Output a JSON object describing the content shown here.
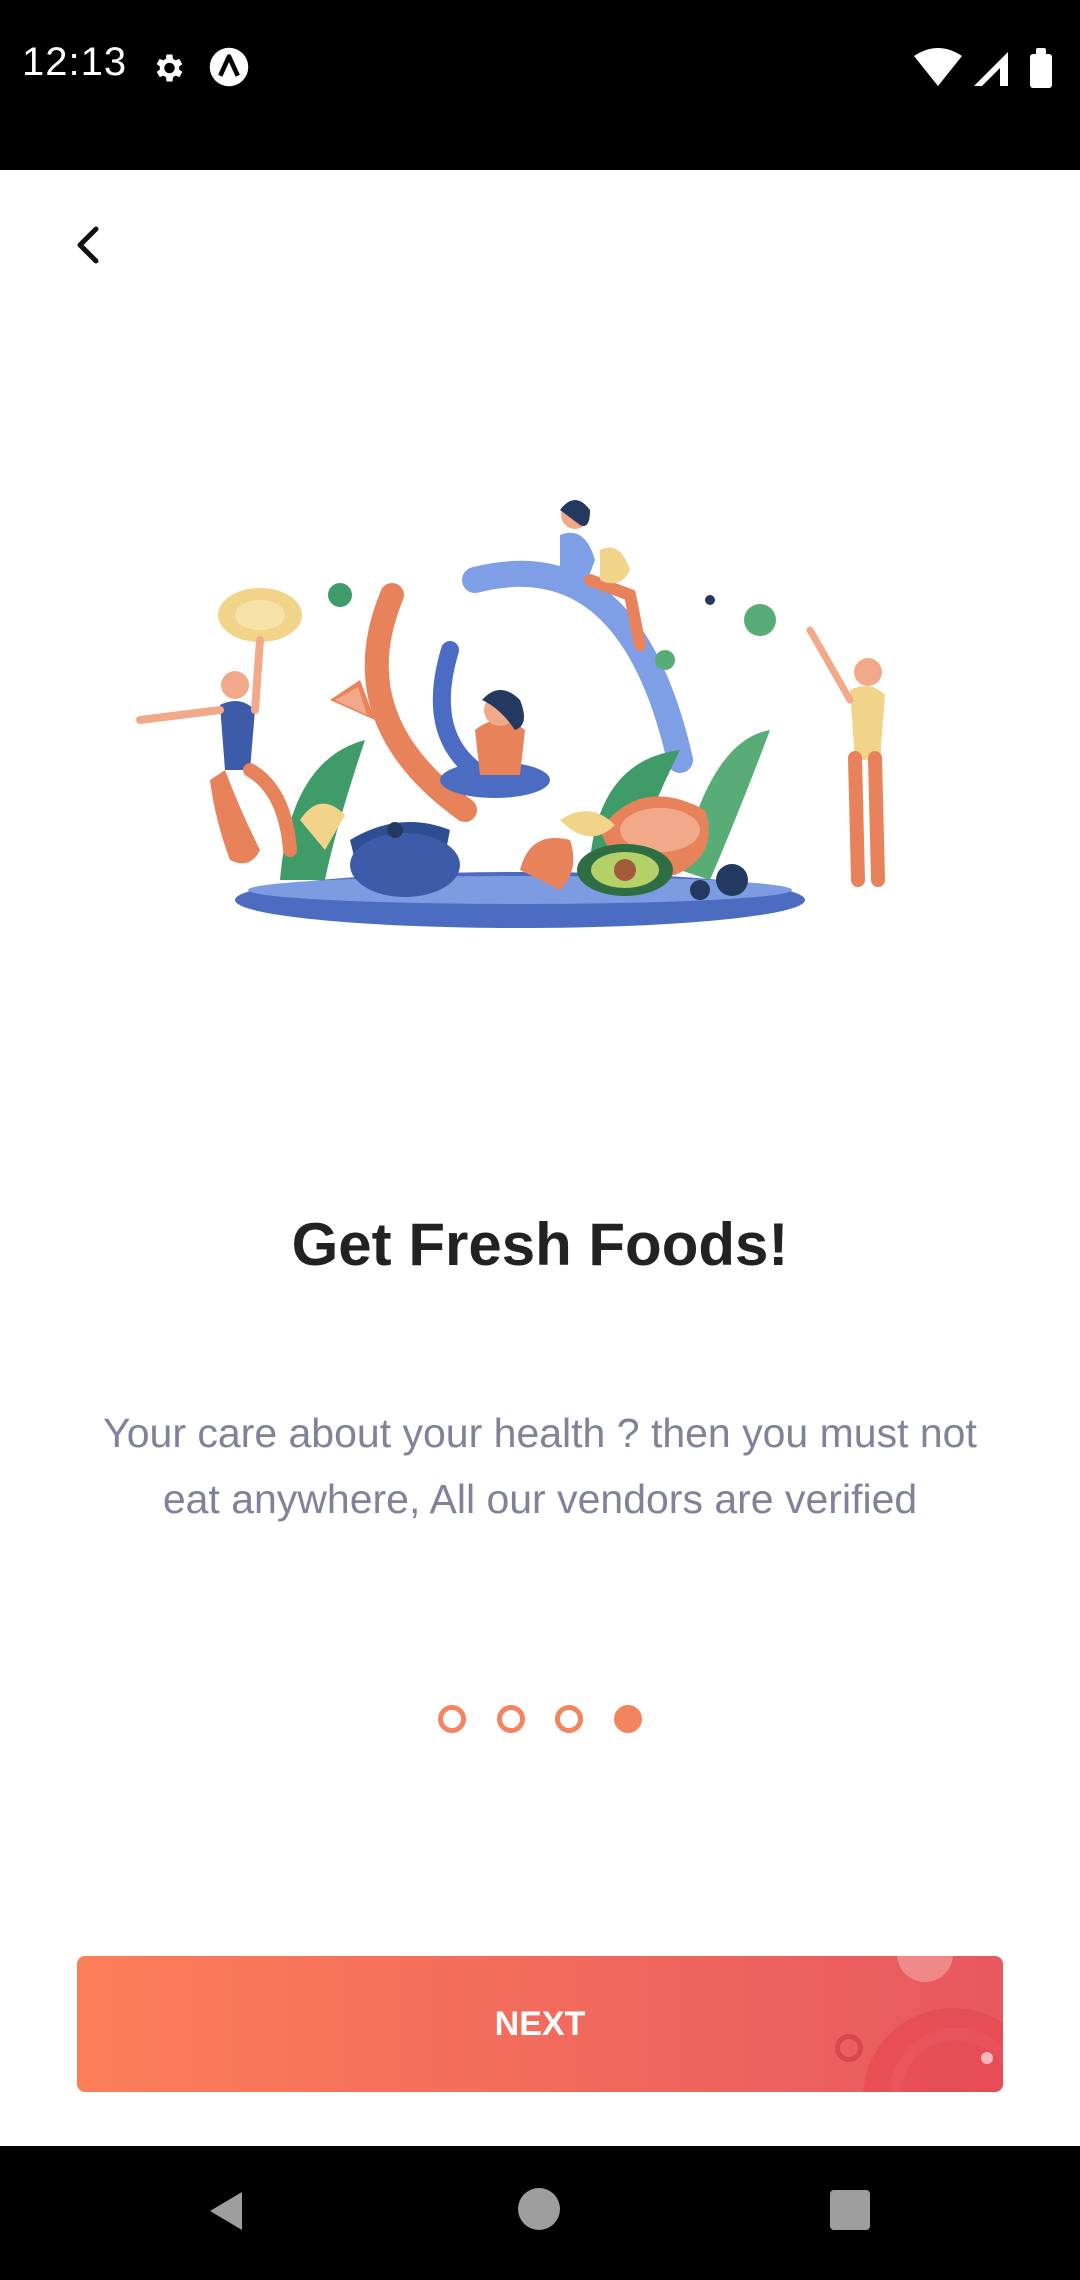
{
  "status_bar": {
    "time": "12:13"
  },
  "onboarding": {
    "title": "Get Fresh Foods!",
    "description": "Your care about your health ? then you must not eat anywhere, All our vendors are verified",
    "page_indicator": {
      "total": 4,
      "current": 4
    },
    "next_label": "NEXT"
  },
  "colors": {
    "accent": "#f4835f",
    "gradient_start": "#fc7e59",
    "gradient_end": "#e8585f"
  },
  "icons": [
    "gear-icon",
    "app-icon",
    "wifi-icon",
    "signal-icon",
    "battery-icon",
    "back-arrow-icon",
    "nav-back-icon",
    "nav-home-icon",
    "nav-recents-icon"
  ]
}
